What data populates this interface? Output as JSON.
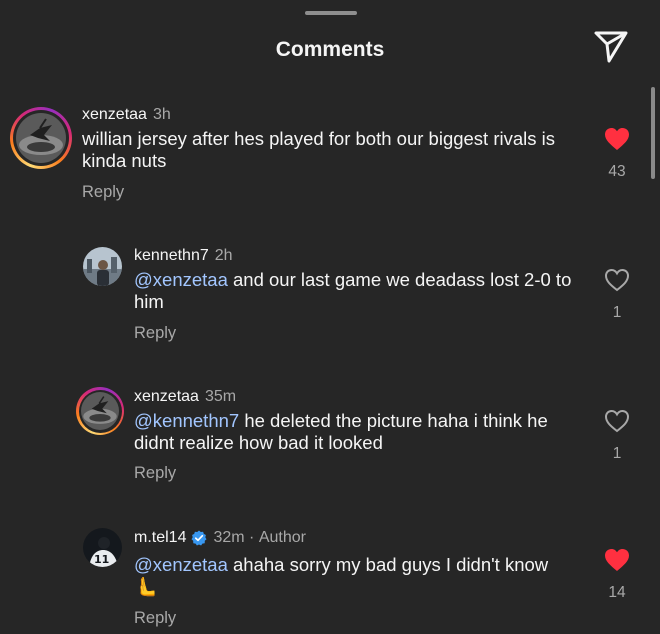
{
  "header": {
    "title": "Comments",
    "share_icon": "paper-plane-icon"
  },
  "colors": {
    "background": "#262626",
    "liked_heart": "#ff3040",
    "mention": "#a2c6ff",
    "verified": "#3897f0"
  },
  "comments": [
    {
      "username": "xenzetaa",
      "time": "3h",
      "text_rest": "willian jersey after hes played for both our biggest rivals is kinda nuts",
      "reply_label": "Reply",
      "liked": true,
      "likes": "43",
      "story_ring": true
    },
    {
      "username": "kennethn7",
      "time": "2h",
      "mention": "@xenzetaa",
      "text_rest": " and our last game we deadass lost 2-0 to him",
      "reply_label": "Reply",
      "liked": false,
      "likes": "1",
      "story_ring": false
    },
    {
      "username": "xenzetaa",
      "time": "35m",
      "mention": "@kennethn7",
      "text_rest": " he deleted the picture haha i think he didnt realize how bad it looked",
      "reply_label": "Reply",
      "liked": false,
      "likes": "1",
      "story_ring": true
    },
    {
      "username": "m.tel14",
      "verified": true,
      "time": "32m",
      "separator": " · ",
      "author_label": "Author",
      "mention": "@xenzetaa",
      "text_rest": " ahaha sorry my bad guys I didn't know",
      "emoji": "🫷",
      "reply_label": "Reply",
      "liked": true,
      "likes": "14",
      "story_ring": false
    }
  ]
}
